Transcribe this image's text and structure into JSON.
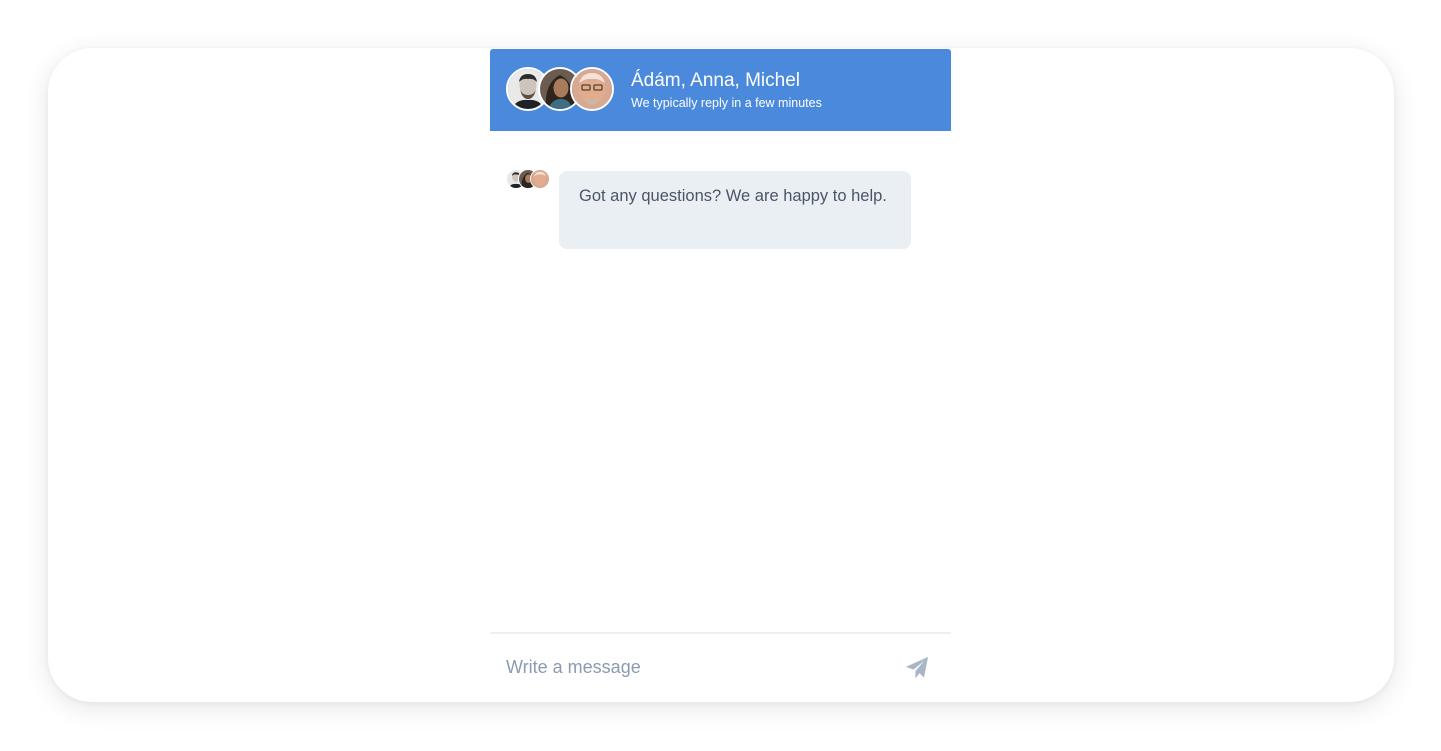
{
  "header": {
    "title": "Ádám, Anna, Michel",
    "subtitle": "We typically reply in a few minutes",
    "avatars": [
      {
        "name": "Ádám",
        "icon": "person-avatar-icon"
      },
      {
        "name": "Anna",
        "icon": "person-avatar-icon"
      },
      {
        "name": "Michel",
        "icon": "person-avatar-icon"
      }
    ]
  },
  "messages": [
    {
      "sender": "team",
      "text": "Got any questions? We are happy to help."
    }
  ],
  "composer": {
    "placeholder": "Write a message",
    "value": "",
    "send_icon": "paper-plane-icon"
  },
  "colors": {
    "accent": "#4a89dc",
    "bubble_background": "#eaeff4",
    "bubble_text": "#4a5568",
    "placeholder": "#8a9bb1",
    "send_icon": "#a9b6c8"
  }
}
